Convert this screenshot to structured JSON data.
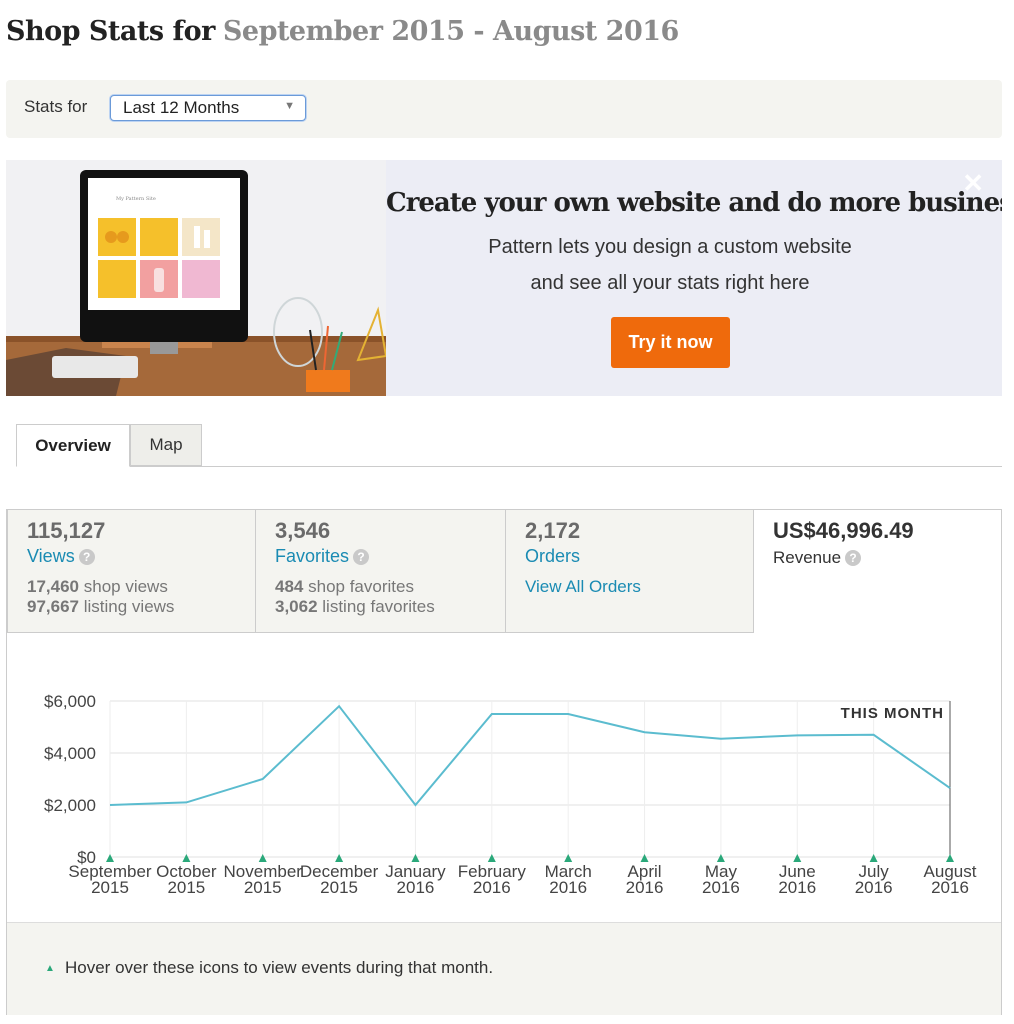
{
  "header": {
    "title_prefix": "Shop Stats for",
    "title_range": "September 2015 - August 2016"
  },
  "stats_for": {
    "label": "Stats for",
    "selected": "Last 12 Months"
  },
  "banner": {
    "headline": "Create your own website and do more business",
    "line1": "Pattern lets you design a custom website",
    "line2": "and see all your stats right here",
    "button": "Try it now",
    "screen_title": "My Pattern Site"
  },
  "tabs": [
    {
      "label": "Overview",
      "active": true
    },
    {
      "label": "Map",
      "active": false
    }
  ],
  "stats": {
    "views": {
      "value": "115,127",
      "label": "Views",
      "shop_num": "17,460",
      "shop_txt": "shop views",
      "listing_num": "97,667",
      "listing_txt": "listing views"
    },
    "favorites": {
      "value": "3,546",
      "label": "Favorites",
      "shop_num": "484",
      "shop_txt": "shop favorites",
      "listing_num": "3,062",
      "listing_txt": "listing favorites"
    },
    "orders": {
      "value": "2,172",
      "label": "Orders",
      "link": "View All Orders"
    },
    "revenue": {
      "value": "US$46,996.49",
      "label": "Revenue"
    }
  },
  "chart_data": {
    "type": "line",
    "categories": [
      [
        "September",
        "2015"
      ],
      [
        "October",
        "2015"
      ],
      [
        "November",
        "2015"
      ],
      [
        "December",
        "2015"
      ],
      [
        "January",
        "2016"
      ],
      [
        "February",
        "2016"
      ],
      [
        "March",
        "2016"
      ],
      [
        "April",
        "2016"
      ],
      [
        "May",
        "2016"
      ],
      [
        "June",
        "2016"
      ],
      [
        "July",
        "2016"
      ],
      [
        "August",
        "2016"
      ]
    ],
    "values": [
      2000,
      2100,
      3000,
      5800,
      2000,
      5500,
      5500,
      4800,
      4550,
      4680,
      4700,
      2650
    ],
    "ylim": [
      0,
      6000
    ],
    "yticks": [
      0,
      2000,
      4000,
      6000
    ],
    "ytick_labels": [
      "$0",
      "$2,000",
      "$4,000",
      "$6,000"
    ],
    "annotation": "THIS MONTH",
    "line_color": "#5bbccf",
    "marker_color": "#2aa87a",
    "grid": true
  },
  "legend": {
    "text": "Hover over these icons to view events during that month."
  },
  "colors": {
    "accent": "#ef6a0c",
    "link": "#1a8bb3"
  }
}
